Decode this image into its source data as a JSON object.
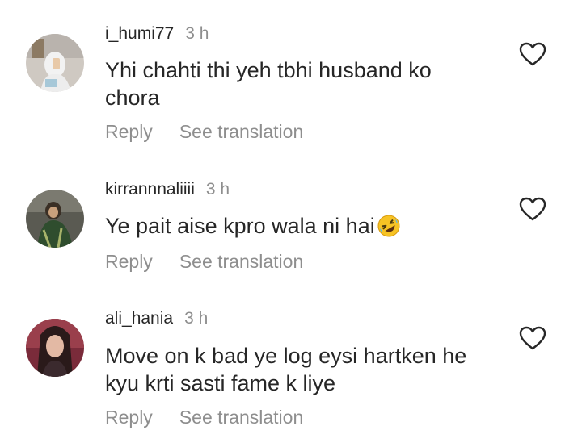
{
  "comments": [
    {
      "username": "i_humi77",
      "time": "3 h",
      "text_line1": "Yhi chahti thi yeh tbhi husband ko",
      "text_line2": "chora",
      "reply_label": "Reply",
      "translate_label": "See translation",
      "avatar_icon": "profile-photo-hijab",
      "like_icon": "heart-outline-icon"
    },
    {
      "username": "kirrannnaliiii",
      "time": "3 h",
      "text_line1": "Ye pait aise kpro wala ni hai",
      "emoji": "rolling-on-floor-laughing-emoji",
      "reply_label": "Reply",
      "translate_label": "See translation",
      "avatar_icon": "profile-photo-green-outfit",
      "like_icon": "heart-outline-icon"
    },
    {
      "username": "ali_hania",
      "time": "3 h",
      "text_line1": "Move on k bad ye log eysi hartken he",
      "text_line2": "kyu krti sasti fame k liye",
      "reply_label": "Reply",
      "translate_label": "See translation",
      "avatar_icon": "profile-photo-dark-hair",
      "like_icon": "heart-outline-icon"
    }
  ],
  "colors": {
    "text_primary": "#262626",
    "text_secondary": "#8e8e8e",
    "background": "#ffffff"
  }
}
